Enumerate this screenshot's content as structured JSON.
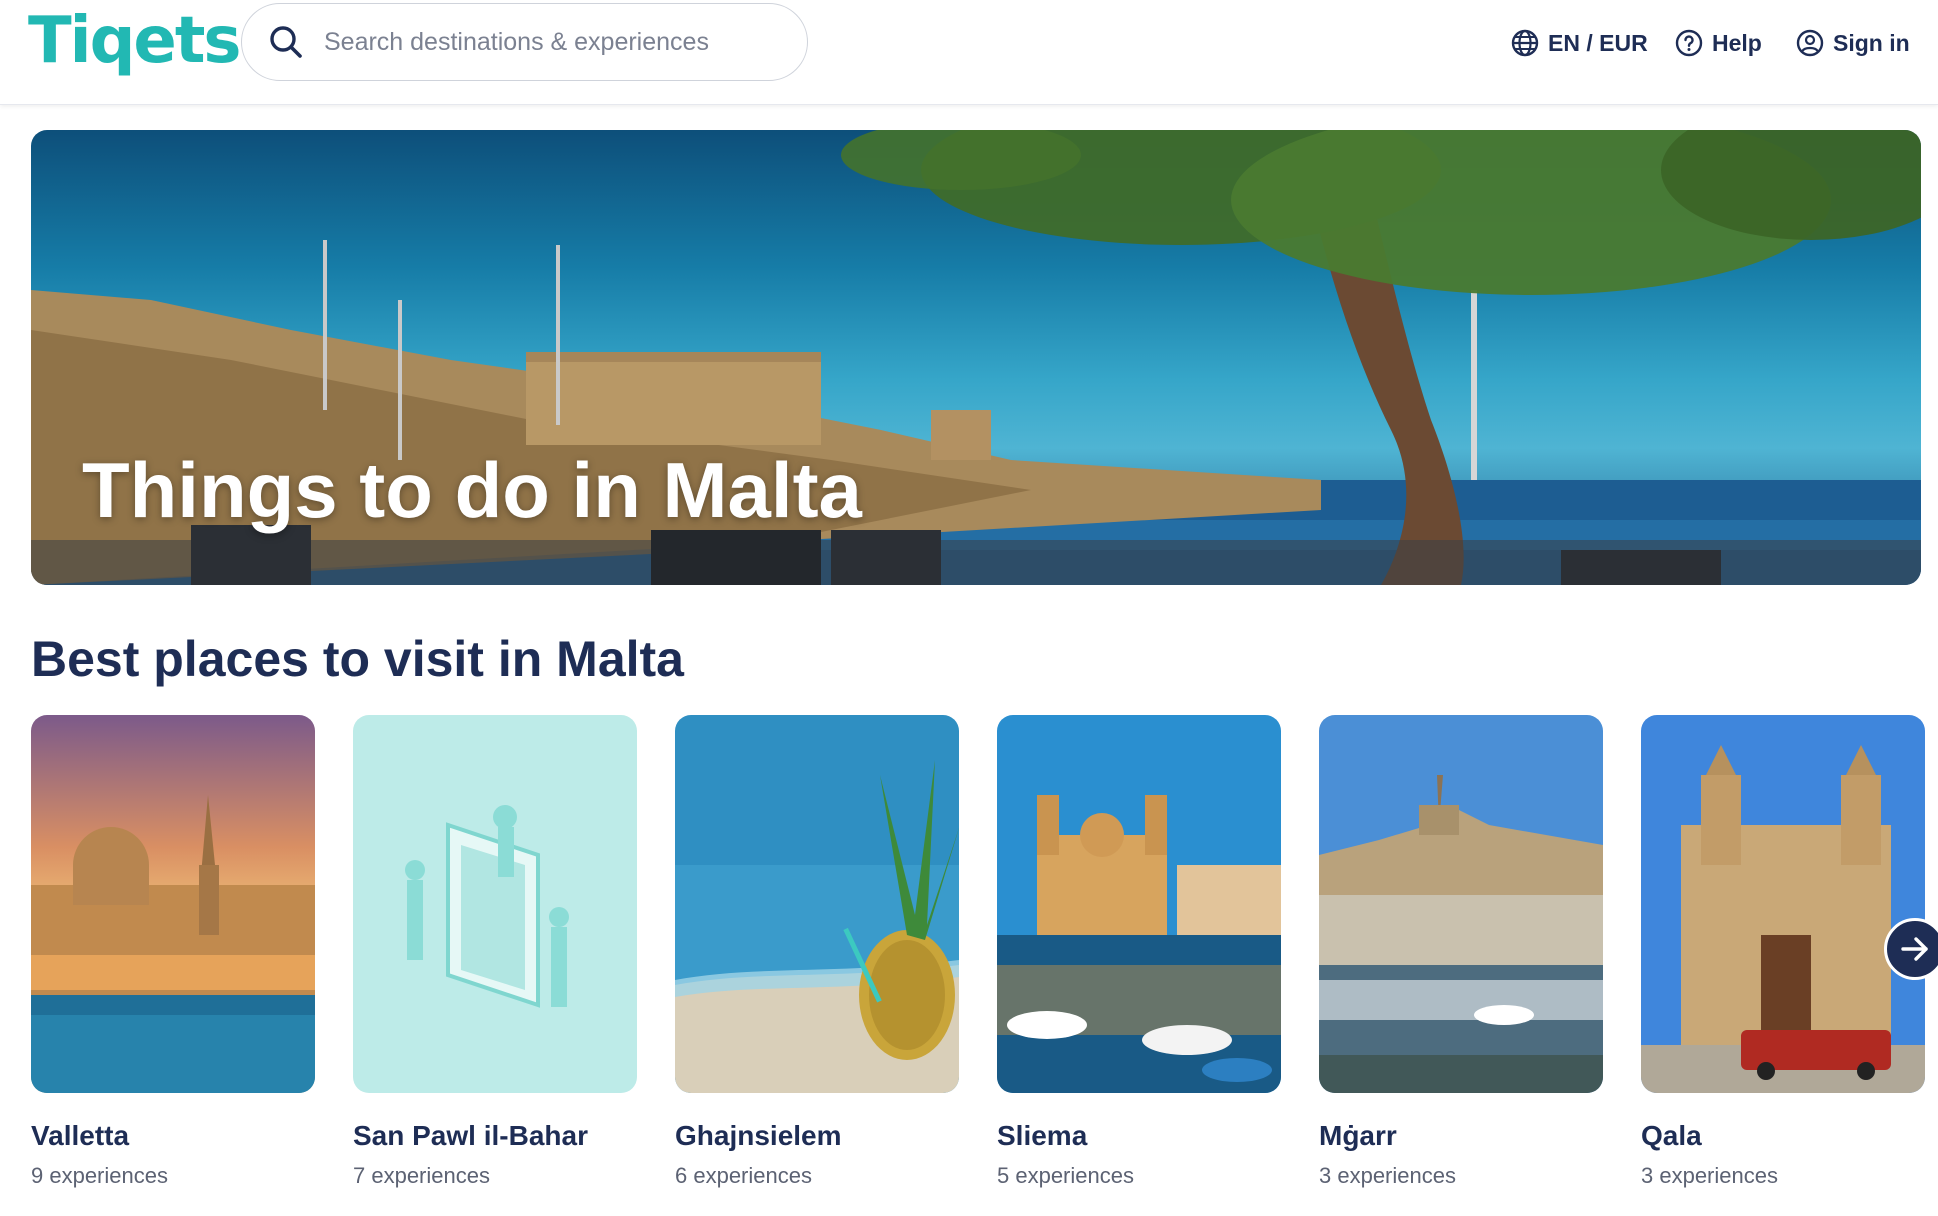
{
  "brand": {
    "logo_text": "Tiqets",
    "accent_color": "#22b8b3",
    "primary_color": "#1e2d55"
  },
  "search": {
    "placeholder": "Search destinations & experiences",
    "icon": "search-icon"
  },
  "nav": {
    "language_currency": "EN / EUR",
    "help": "Help",
    "sign_in": "Sign in"
  },
  "hero": {
    "title": "Things to do in Malta"
  },
  "places": {
    "title": "Best places to visit in Malta",
    "items": [
      {
        "name": "Valletta",
        "count": "9 experiences"
      },
      {
        "name": "San Pawl il-Bahar",
        "count": "7 experiences"
      },
      {
        "name": "Ghajnsielem",
        "count": "6 experiences"
      },
      {
        "name": "Sliema",
        "count": "5 experiences"
      },
      {
        "name": "Mġarr",
        "count": "3 experiences"
      },
      {
        "name": "Qala",
        "count": "3 experiences"
      }
    ],
    "next_icon": "arrow-right-icon"
  }
}
